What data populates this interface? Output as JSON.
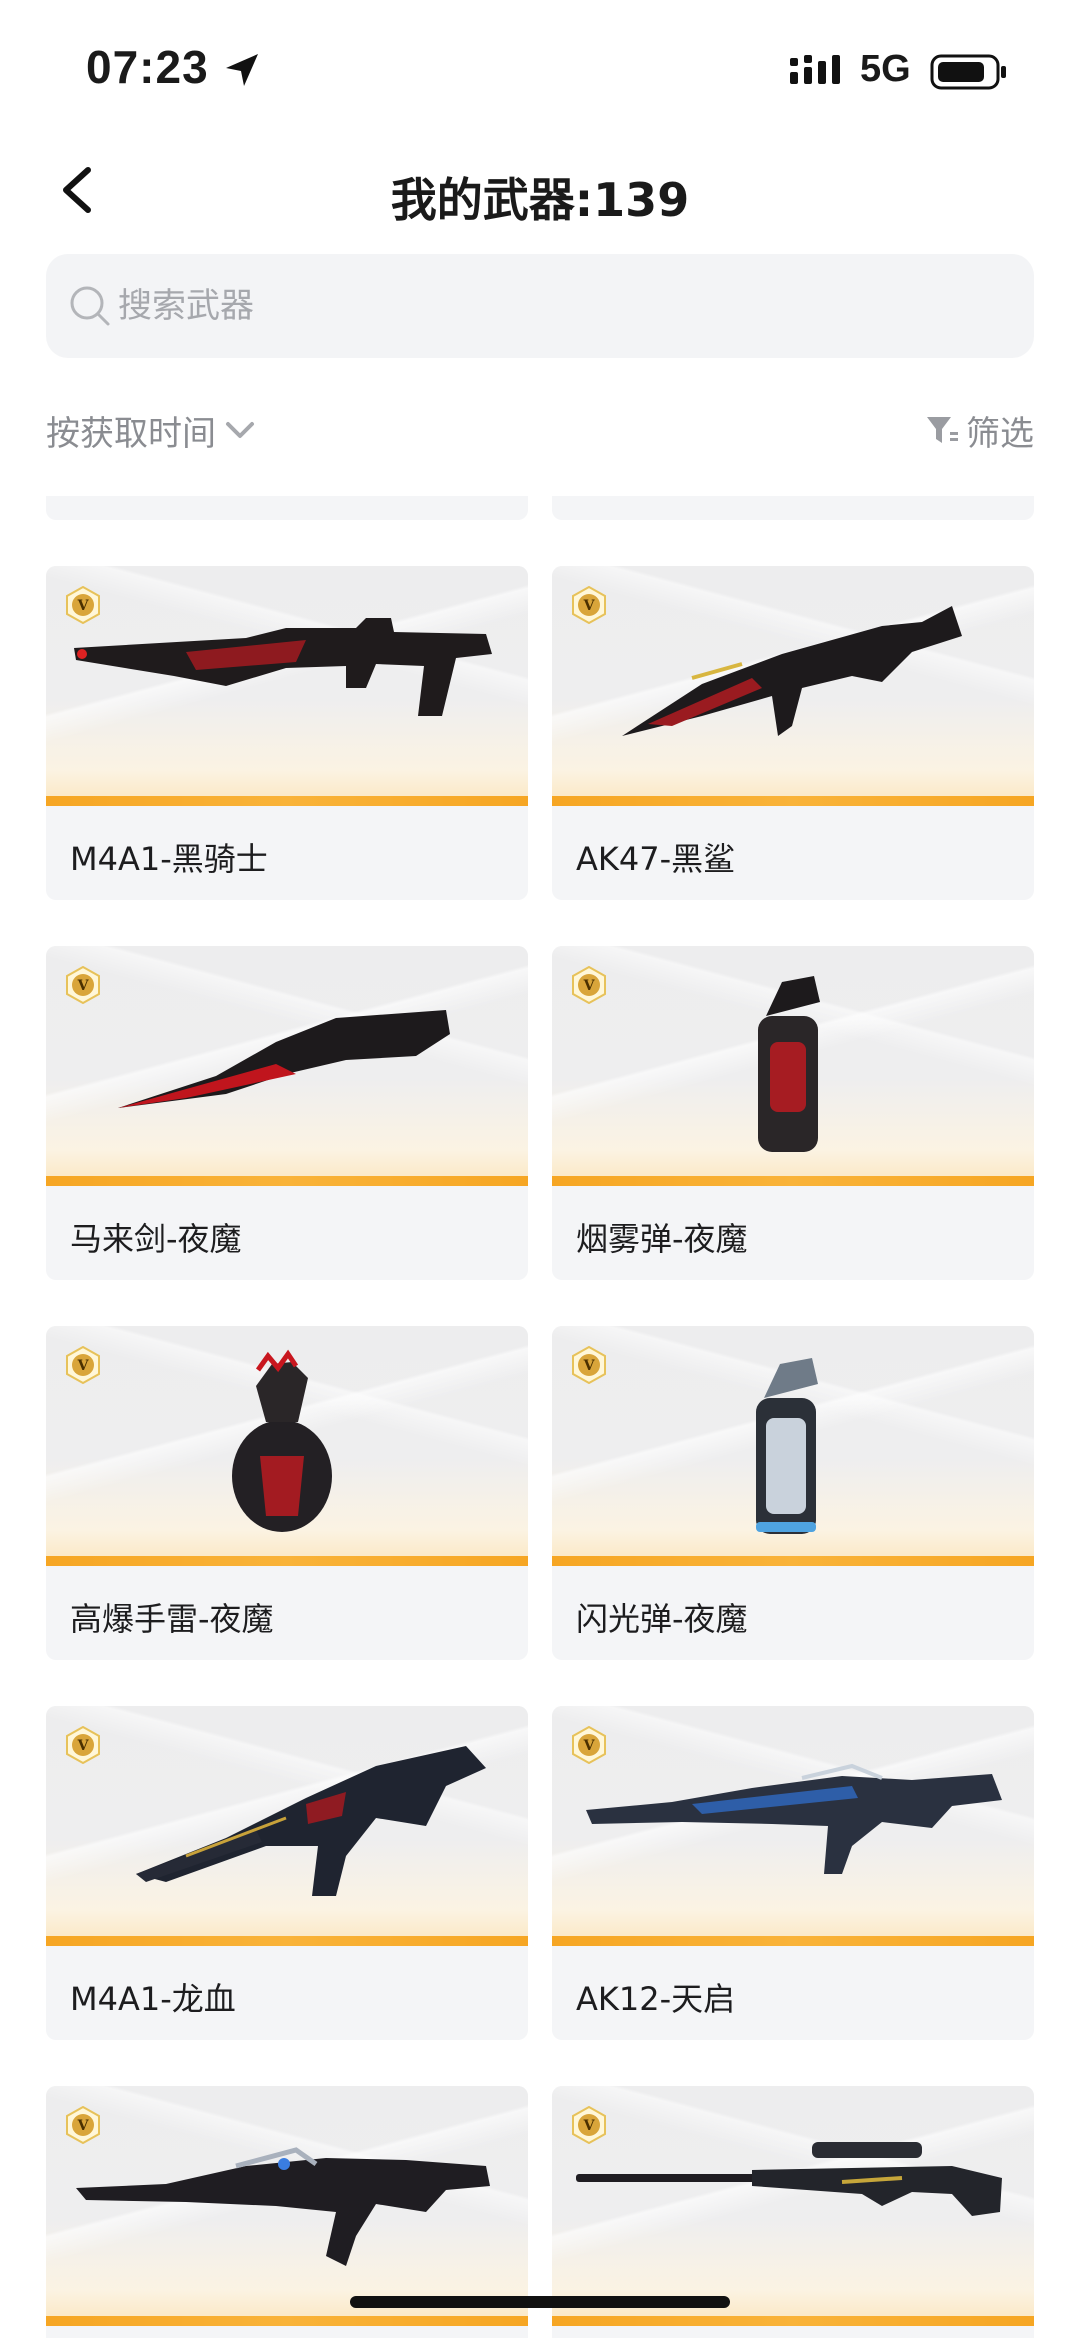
{
  "status_bar": {
    "time": "07:23",
    "network": "5G"
  },
  "header": {
    "title": "我的武器:139"
  },
  "search": {
    "placeholder": "搜索武器"
  },
  "sort": {
    "label": "按获取时间"
  },
  "filter": {
    "label": "筛选"
  },
  "colors": {
    "accent_bar": "#f6a623",
    "card_bg": "#f4f5f7",
    "badge_gold": "#d9a53a"
  },
  "weapons": [
    {
      "name": "M4A1-黑骑士",
      "icon": "rifle-icon"
    },
    {
      "name": "AK47-黑鲨",
      "icon": "rifle-icon"
    },
    {
      "name": "马来剑-夜魔",
      "icon": "blade-icon"
    },
    {
      "name": "烟雾弹-夜魔",
      "icon": "smoke-grenade-icon"
    },
    {
      "name": "高爆手雷-夜魔",
      "icon": "grenade-icon"
    },
    {
      "name": "闪光弹-夜魔",
      "icon": "flashbang-icon"
    },
    {
      "name": "M4A1-龙血",
      "icon": "rifle-icon"
    },
    {
      "name": "AK12-天启",
      "icon": "rifle-icon"
    },
    {
      "name": "",
      "icon": "rifle-icon"
    },
    {
      "name": "",
      "icon": "sniper-rifle-icon"
    }
  ]
}
